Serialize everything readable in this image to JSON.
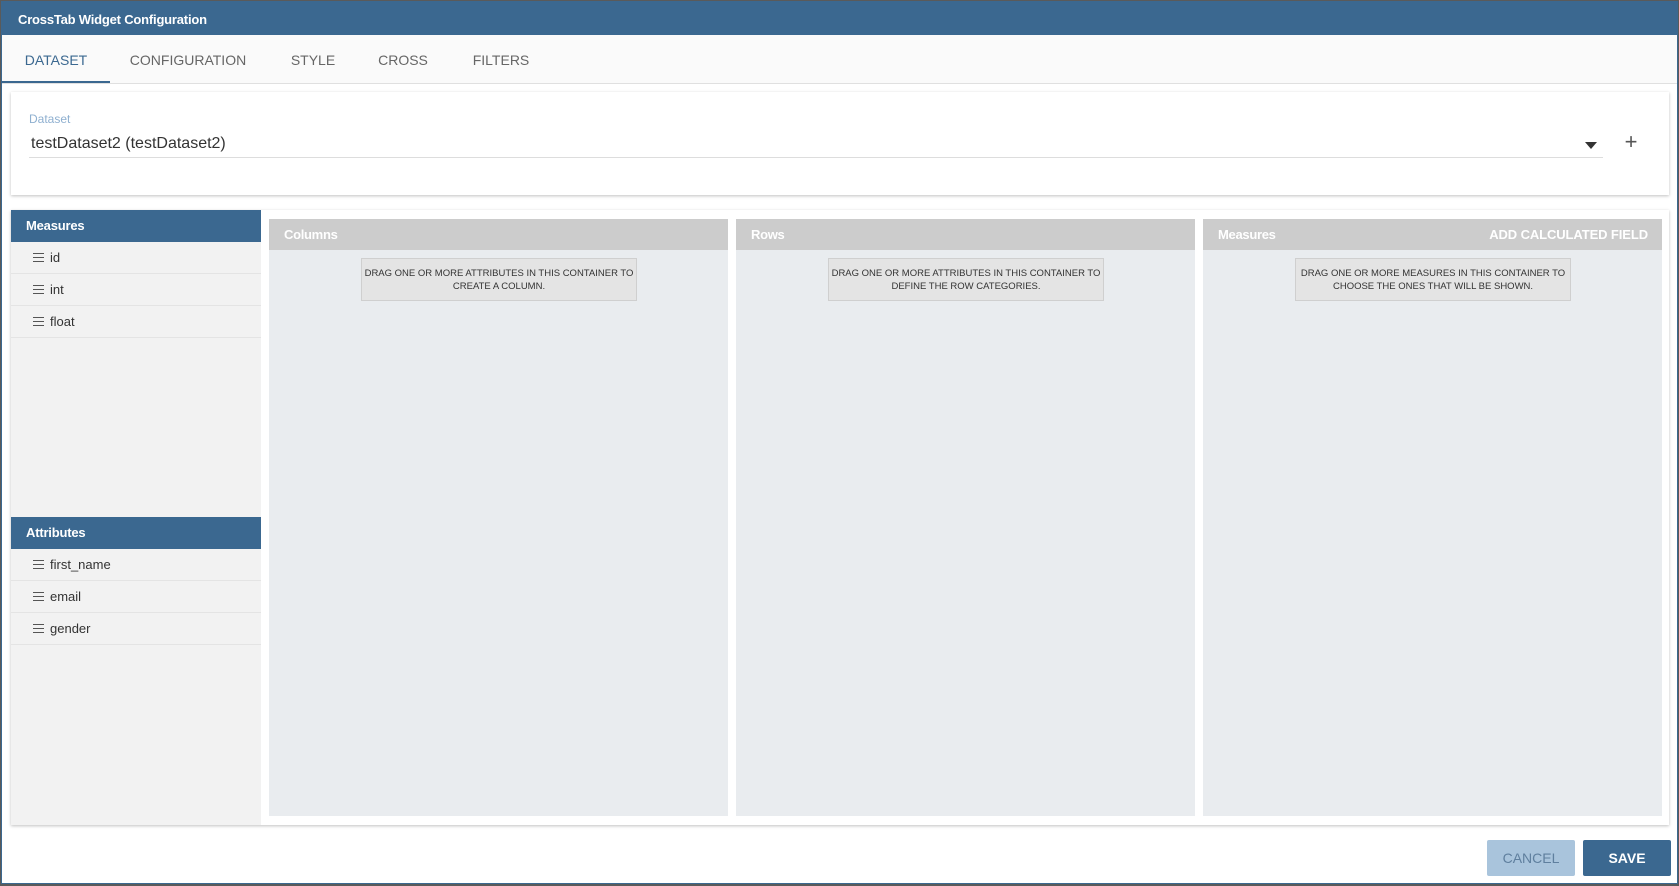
{
  "window": {
    "title": "CrossTab Widget Configuration"
  },
  "tabs": [
    {
      "label": "DATASET",
      "active": true
    },
    {
      "label": "CONFIGURATION",
      "active": false
    },
    {
      "label": "STYLE",
      "active": false
    },
    {
      "label": "CROSS",
      "active": false
    },
    {
      "label": "FILTERS",
      "active": false
    }
  ],
  "dataset": {
    "label": "Dataset",
    "selected": "testDataset2 (testDataset2)",
    "add_icon": "plus-icon",
    "dropdown_icon": "caret-down-icon"
  },
  "sidebar": {
    "measures_header": "Measures",
    "measures": [
      "id",
      "int",
      "float"
    ],
    "attributes_header": "Attributes",
    "attributes": [
      "first_name",
      "email",
      "gender"
    ],
    "item_icon": "drag-handle-icon"
  },
  "panels": {
    "columns": {
      "title": "Columns",
      "hint": "DRAG ONE OR MORE ATTRIBUTES IN THIS CONTAINER TO CREATE A COLUMN."
    },
    "rows": {
      "title": "Rows",
      "hint": "DRAG ONE OR MORE ATTRIBUTES IN THIS CONTAINER TO DEFINE THE ROW CATEGORIES."
    },
    "measures": {
      "title": "Measures",
      "action": "ADD CALCULATED FIELD",
      "hint": "DRAG ONE OR MORE MEASURES IN THIS CONTAINER TO CHOOSE THE ONES THAT WILL BE SHOWN."
    }
  },
  "footer": {
    "cancel_label": "CANCEL",
    "save_label": "SAVE"
  },
  "colors": {
    "primary": "#3b6890",
    "panel_header": "#cccccc",
    "panel_bg": "#e9ecef",
    "cancel_bg": "#a9c4dc"
  }
}
